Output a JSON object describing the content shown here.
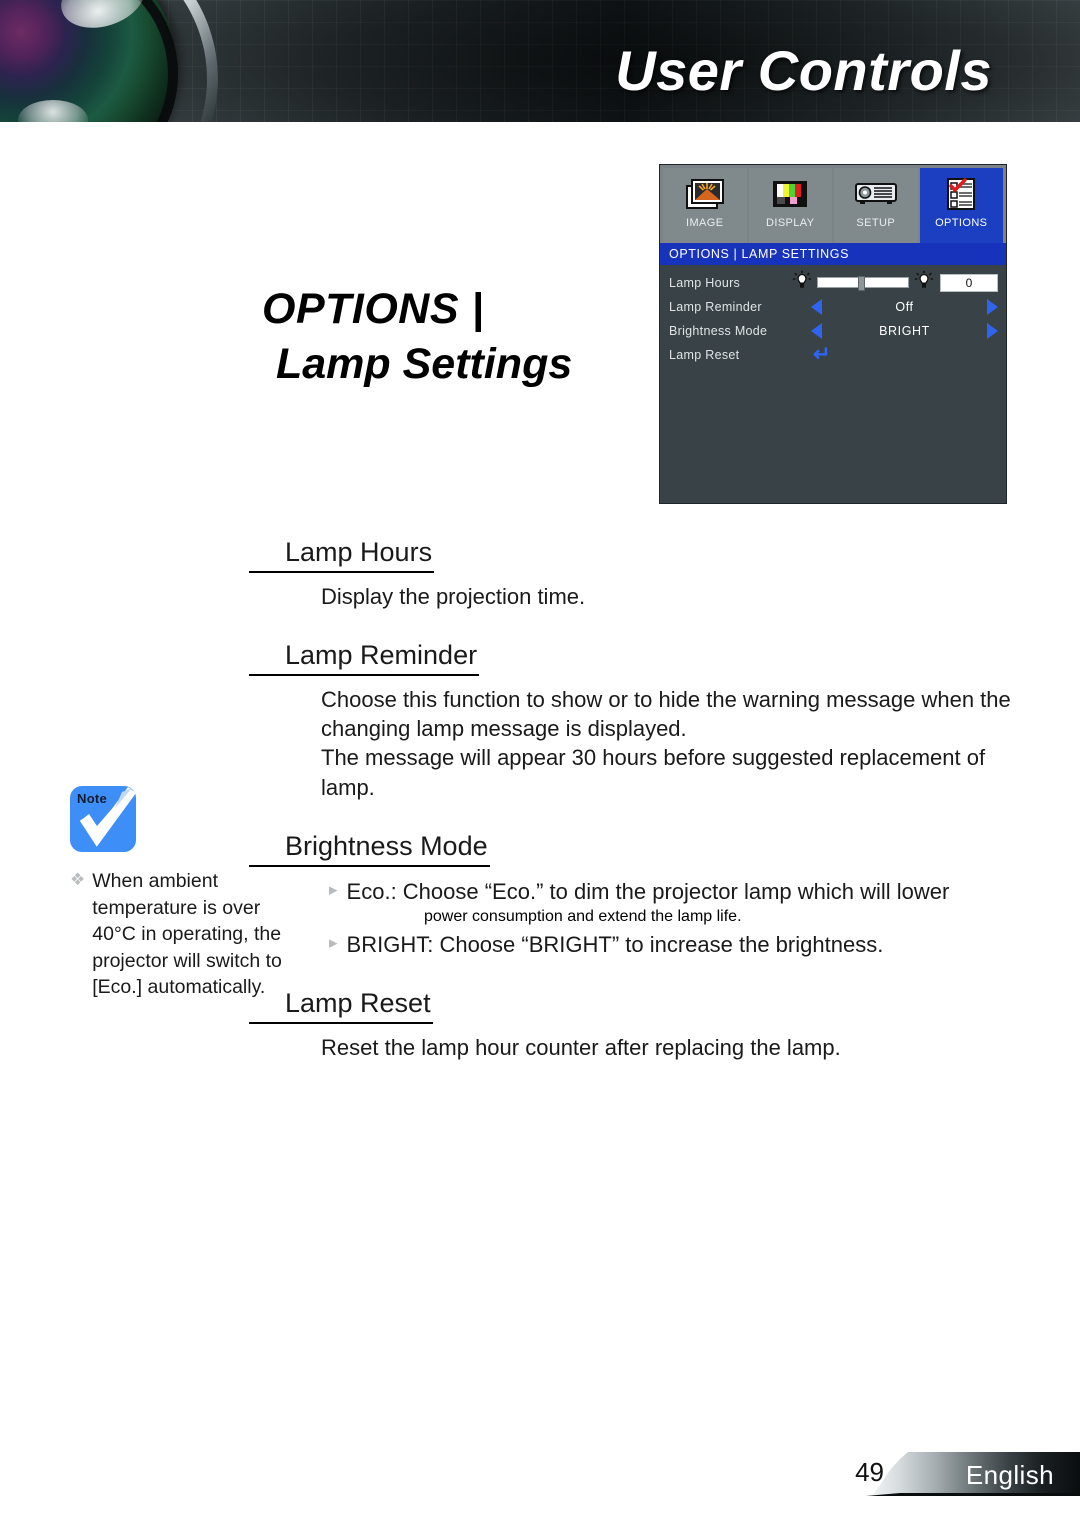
{
  "header": {
    "title": "User Controls",
    "lens_icon": "camera-lens-graphic"
  },
  "page_title": {
    "line1": "OPTIONS |",
    "line2": "Lamp Settings"
  },
  "osd": {
    "tabs": [
      {
        "label": "IMAGE",
        "icon": "image-photo-icon",
        "active": false
      },
      {
        "label": "DISPLAY",
        "icon": "color-bars-icon",
        "active": false
      },
      {
        "label": "SETUP",
        "icon": "projector-icon",
        "active": false
      },
      {
        "label": "OPTIONS",
        "icon": "checklist-icon",
        "active": true
      }
    ],
    "titlebar": "OPTIONS | LAMP SETTINGS",
    "rows": [
      {
        "label": "Lamp Hours",
        "control": "slider",
        "value": "0",
        "slider_percent": 44,
        "left_icon": "lamp-bulb-icon",
        "right_icon": "lamp-bulb-icon"
      },
      {
        "label": "Lamp Reminder",
        "control": "arrows",
        "value": "Off",
        "left_icon": "arrow-left-icon",
        "right_icon": "arrow-right-icon"
      },
      {
        "label": "Brightness Mode",
        "control": "arrows",
        "value": "BRIGHT",
        "left_icon": "arrow-left-icon",
        "right_icon": "arrow-right-icon"
      },
      {
        "label": "Lamp Reset",
        "control": "enter",
        "value": "↵",
        "left_icon": "enter-return-icon"
      }
    ],
    "colors": {
      "panel_bg": "#394246",
      "tab_bg": "#808a8d",
      "tab_active": "#1b3fc0",
      "titlebar": "#1733bb",
      "arrow_blue": "#2f64f0"
    }
  },
  "sections": [
    {
      "heading": "Lamp Hours",
      "paragraphs": [
        "Display the projection time."
      ]
    },
    {
      "heading": "Lamp Reminder",
      "paragraphs": [
        "Choose this function to show or to hide the warning message when the changing lamp message is displayed.",
        "The message will appear 30 hours before suggested replacement of lamp."
      ]
    },
    {
      "heading": "Brightness Mode",
      "bullets": [
        {
          "marker": "▸",
          "text": "Eco.: Choose “Eco.” to dim the projector lamp which will lower",
          "continuation": "power consumption and extend the lamp life."
        },
        {
          "marker": "▸",
          "text": "BRIGHT: Choose “BRIGHT” to increase the brightness."
        }
      ]
    },
    {
      "heading": "Lamp Reset",
      "paragraphs": [
        "Reset the lamp hour counter after replacing the lamp."
      ]
    }
  ],
  "note": {
    "icon_label": "Note",
    "icon_glyph": "check-mark-icon",
    "marker": "❖",
    "text": "When ambient temperature is over 40°C in operating, the projector will switch to [Eco.] automatically."
  },
  "footer": {
    "page_number": "49",
    "language": "English"
  }
}
